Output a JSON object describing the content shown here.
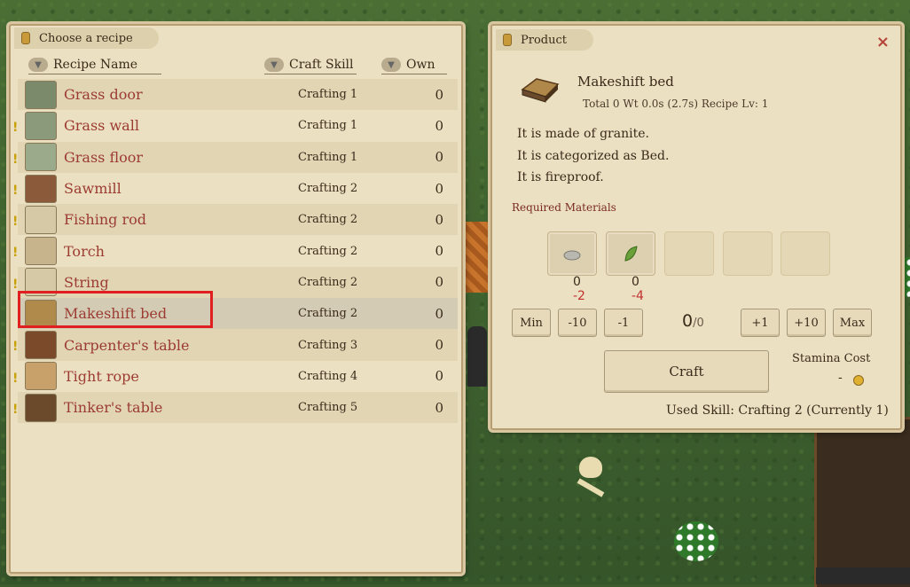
{
  "left_panel": {
    "tab_title": "Choose a recipe",
    "columns": {
      "name": "Recipe Name",
      "skill": "Craft Skill",
      "own": "Own"
    },
    "recipes": [
      {
        "name": "Grass door",
        "skill": "Crafting 1",
        "own": "0",
        "warn": false,
        "icon": "grass-door-icon",
        "color": "#7a8a6a"
      },
      {
        "name": "Grass wall",
        "skill": "Crafting 1",
        "own": "0",
        "warn": true,
        "icon": "grass-wall-icon",
        "color": "#8a9a7a"
      },
      {
        "name": "Grass floor",
        "skill": "Crafting 1",
        "own": "0",
        "warn": true,
        "icon": "grass-floor-icon",
        "color": "#9aaa8a"
      },
      {
        "name": "Sawmill",
        "skill": "Crafting 2",
        "own": "0",
        "warn": true,
        "icon": "sawmill-icon",
        "color": "#8a5a3a"
      },
      {
        "name": "Fishing rod",
        "skill": "Crafting 2",
        "own": "0",
        "warn": true,
        "icon": "fishing-rod-icon",
        "color": "#d6c9a6"
      },
      {
        "name": "Torch",
        "skill": "Crafting 2",
        "own": "0",
        "warn": true,
        "icon": "torch-icon",
        "color": "#c8b48c"
      },
      {
        "name": "String",
        "skill": "Crafting 2",
        "own": "0",
        "warn": true,
        "icon": "string-icon",
        "color": "#d6c9a6"
      },
      {
        "name": "Makeshift bed",
        "skill": "Crafting 2",
        "own": "0",
        "warn": false,
        "icon": "makeshift-bed-icon",
        "color": "#b08a4a"
      },
      {
        "name": "Carpenter's table",
        "skill": "Crafting 3",
        "own": "0",
        "warn": true,
        "icon": "carpenters-table-icon",
        "color": "#7a4a2a"
      },
      {
        "name": "Tight rope",
        "skill": "Crafting 4",
        "own": "0",
        "warn": true,
        "icon": "tight-rope-icon",
        "color": "#c8a06a"
      },
      {
        "name": "Tinker's table",
        "skill": "Crafting 5",
        "own": "0",
        "warn": true,
        "icon": "tinkers-table-icon",
        "color": "#6a4a2a"
      }
    ],
    "selected_index": 7
  },
  "right_panel": {
    "tab_title": "Product",
    "close": "×",
    "product_name": "Makeshift bed",
    "stats": "Total 0  Wt 0.0s (2.7s)  Recipe Lv: 1",
    "desc": [
      "It is made of granite.",
      "It is categorized as Bed.",
      "It is fireproof."
    ],
    "required_label": "Required Materials",
    "materials": [
      {
        "have": "0",
        "need": "-2",
        "icon": "stone-material-icon"
      },
      {
        "have": "0",
        "need": "-4",
        "icon": "leaf-material-icon"
      }
    ],
    "buttons": {
      "min": "Min",
      "minus10": "-10",
      "minus1": "-1",
      "plus1": "+1",
      "plus10": "+10",
      "max": "Max"
    },
    "quantity": "0",
    "quantity_max": "/0",
    "craft": "Craft",
    "stamina_label": "Stamina Cost",
    "stamina_value": "-",
    "used_skill": "Used Skill: Crafting 2 (Currently 1)"
  },
  "colors": {
    "recipe_name": "#9b3b32",
    "highlight": "#e02020",
    "panel": "#ece0c2"
  }
}
